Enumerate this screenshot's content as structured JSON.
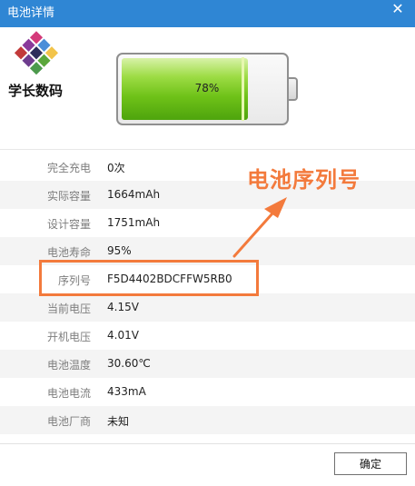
{
  "window": {
    "title": "电池详情",
    "close_glyph": "✕"
  },
  "logo": {
    "text": "学长数码"
  },
  "battery": {
    "percent_label": "78%",
    "level": 0.78
  },
  "details": [
    {
      "label": "完全充电",
      "value": "0次"
    },
    {
      "label": "实际容量",
      "value": "1664mAh"
    },
    {
      "label": "设计容量",
      "value": "1751mAh"
    },
    {
      "label": "电池寿命",
      "value": "95%"
    },
    {
      "label": "序列号",
      "value": "F5D4402BDCFFW5RB0"
    },
    {
      "label": "当前电压",
      "value": "4.15V"
    },
    {
      "label": "开机电压",
      "value": "4.01V"
    },
    {
      "label": "电池温度",
      "value": "30.60℃"
    },
    {
      "label": "电池电流",
      "value": "433mA"
    },
    {
      "label": "电池厂商",
      "value": "未知"
    }
  ],
  "annotation": {
    "text": "电池序列号",
    "color": "#f37a3c"
  },
  "footer": {
    "ok_label": "确定"
  },
  "colors": {
    "titlebar": "#2f86d4",
    "battery_green": "#6fc218"
  }
}
